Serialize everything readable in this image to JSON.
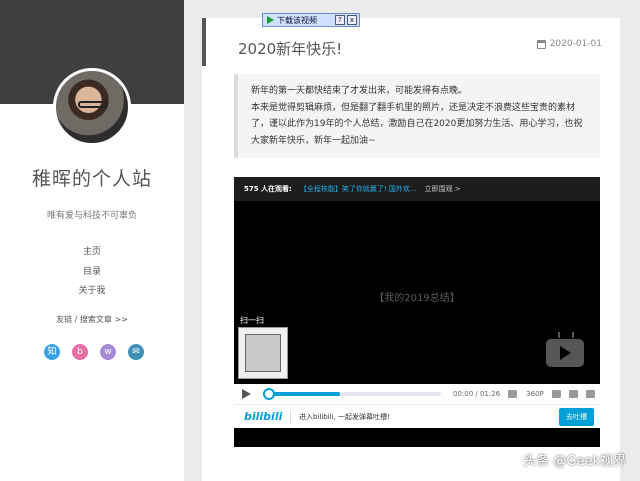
{
  "sidebar": {
    "title": "稚晖的个人站",
    "subtitle": "唯有爱与科技不可辜负",
    "nav": [
      "主页",
      "目录",
      "关于我"
    ],
    "links_text": "友链 / 搜索文章 >>",
    "socials": [
      {
        "icon": "zhihu-icon",
        "glyph": "知",
        "color": "#3ba2e8"
      },
      {
        "icon": "bilibili-icon",
        "glyph": "b",
        "color": "#e66fa8"
      },
      {
        "icon": "weibo-icon",
        "glyph": "w",
        "color": "#a68ad8"
      },
      {
        "icon": "email-icon",
        "glyph": "✉",
        "color": "#3d8fb5"
      }
    ]
  },
  "download_bar": {
    "label": "下载该视频",
    "help": "?",
    "close": "x"
  },
  "post": {
    "title": "2020新年快乐!",
    "date": "2020-01-01",
    "quote_line1": "新年的第一天都快结束了才发出来，可能发得有点晚。",
    "quote_rest": "本来是觉得剪辑麻烦，但是翻了翻手机里的照片，还是决定不浪费这些宝贵的素材了，谨以此作为19年的个人总结，激励自己在2020更加努力生活、用心学习，也祝大家新年快乐，新年一起加油~"
  },
  "player": {
    "watching": "575 人在观看:",
    "promo": "【全程核能】笑了你就赢了! 国外欢...",
    "watch_now": "立即围观 >",
    "center_text": "【我的2019总结】",
    "overlay_label": "扫一扫",
    "time": "00:00 / 01:26",
    "quality": "360P",
    "progress": 0.0,
    "buffered": 0.43,
    "brand": "bilibili",
    "cta_text": "进入bilibili, 一起发弹幕吐槽!",
    "cta_button": "去吐槽"
  },
  "watermark": "头条 @Geek视界"
}
